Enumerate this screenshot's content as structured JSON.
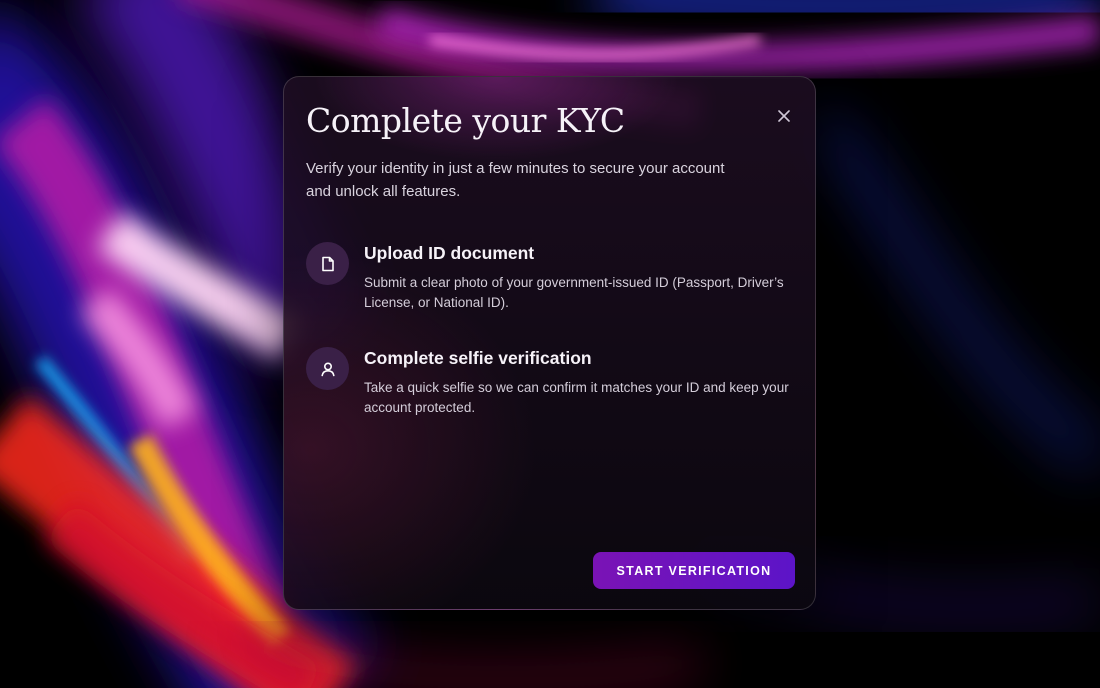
{
  "modal": {
    "title": "Complete your KYC",
    "subtitle": "Verify your identity in just a few minutes to secure your account and unlock all features.",
    "close_icon": "close-icon",
    "steps": [
      {
        "icon": "document-icon",
        "title": "Upload ID document",
        "description": "Submit a clear photo of your government-issued ID (Passport, Driver’s License, or National ID)."
      },
      {
        "icon": "user-icon",
        "title": "Complete selfie verification",
        "description": "Take a quick selfie so we can confirm it matches your ID and keep your account protected."
      }
    ],
    "primary_button_label": "START VERIFICATION"
  },
  "colors": {
    "accent": "#7a13b5",
    "accent_end": "#5c14c8",
    "icon_circle": "#3a2047",
    "background": "#000000"
  }
}
